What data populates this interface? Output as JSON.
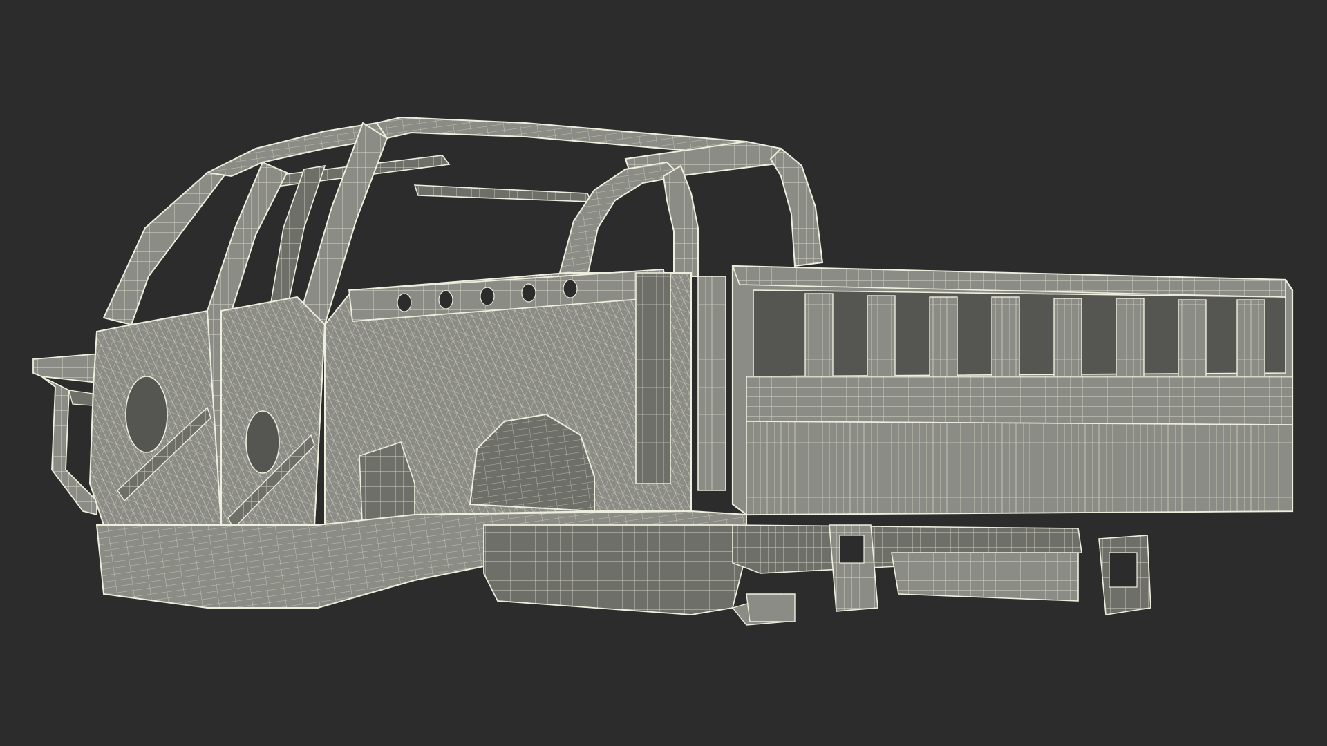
{
  "scene": {
    "subject": "pickup-truck-body-frame-wireframe",
    "colors": {
      "background": "#2c2c2c",
      "panel_fill": "#8c8c86",
      "panel_shade": "#6f6f6a",
      "panel_dark": "#555551",
      "wire": "#eeeedf"
    }
  }
}
